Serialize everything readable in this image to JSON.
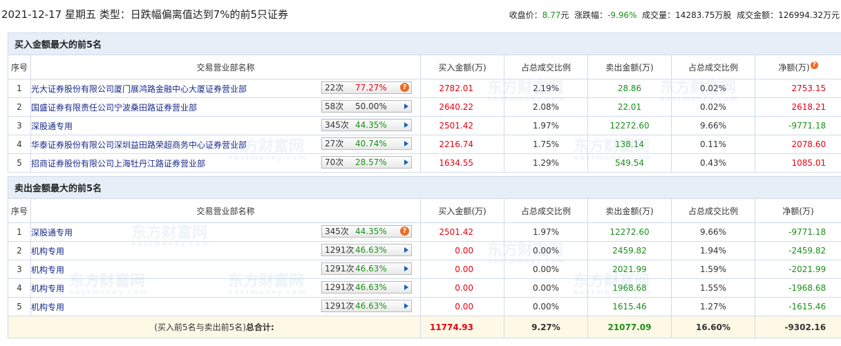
{
  "header": {
    "title": "2021-12-17 星期五 类型：日跌幅偏离值达到7%的前5只证券",
    "close_label": "收盘价：",
    "close_value": "8.77",
    "close_unit": "元",
    "change_label": "涨跌幅：",
    "change_value": "-9.96%",
    "volume_label": "成交量：",
    "volume_value": "14283.75万股",
    "amount_label": "成交金额：",
    "amount_value": "126994.32万元"
  },
  "columns": [
    "序号",
    "交易营业部名称",
    "买入金额(万)",
    "占总成交比例",
    "卖出金额(万)",
    "占总成交比例",
    "净额(万)"
  ],
  "buy_section": {
    "title": "买入金额最大的前5名",
    "rows": [
      {
        "idx": "1",
        "name": "光大证券股份有限公司厦门展鸿路金融中心大厦证券营业部",
        "count": "22次",
        "rate": "77.27%",
        "rate_color": "red",
        "icon": "hot",
        "buy": "2782.01",
        "buy_pct": "2.19%",
        "sell": "28.86",
        "sell_pct": "0.02%",
        "net": "2753.15",
        "net_color": "red"
      },
      {
        "idx": "2",
        "name": "国盛证券有限责任公司宁波桑田路证券营业部",
        "count": "58次",
        "rate": "50.00%",
        "rate_color": "black",
        "icon": "arrow",
        "buy": "2640.22",
        "buy_pct": "2.08%",
        "sell": "22.01",
        "sell_pct": "0.02%",
        "net": "2618.21",
        "net_color": "red"
      },
      {
        "idx": "3",
        "name": "深股通专用",
        "count": "345次",
        "rate": "44.35%",
        "rate_color": "green",
        "icon": "arrow",
        "buy": "2501.42",
        "buy_pct": "1.97%",
        "sell": "12272.60",
        "sell_pct": "9.66%",
        "net": "-9771.18",
        "net_color": "green"
      },
      {
        "idx": "4",
        "name": "华泰证券股份有限公司深圳益田路荣超商务中心证券营业部",
        "count": "27次",
        "rate": "40.74%",
        "rate_color": "green",
        "icon": "arrow",
        "buy": "2216.74",
        "buy_pct": "1.75%",
        "sell": "138.14",
        "sell_pct": "0.11%",
        "net": "2078.60",
        "net_color": "red"
      },
      {
        "idx": "5",
        "name": "招商证券股份有限公司上海牡丹江路证券营业部",
        "count": "70次",
        "rate": "28.57%",
        "rate_color": "green",
        "icon": "arrow",
        "buy": "1634.55",
        "buy_pct": "1.29%",
        "sell": "549.54",
        "sell_pct": "0.43%",
        "net": "1085.01",
        "net_color": "red"
      }
    ]
  },
  "sell_section": {
    "title": "卖出金额最大的前5名",
    "rows": [
      {
        "idx": "1",
        "name": "深股通专用",
        "count": "345次",
        "rate": "44.35%",
        "rate_color": "green",
        "icon": "hot",
        "buy": "2501.42",
        "buy_pct": "1.97%",
        "sell": "12272.60",
        "sell_pct": "9.66%",
        "net": "-9771.18",
        "net_color": "green"
      },
      {
        "idx": "2",
        "name": "机构专用",
        "count": "1291次",
        "rate": "46.63%",
        "rate_color": "green",
        "icon": "arrow",
        "buy": "0.00",
        "buy_pct": "0.00%",
        "sell": "2459.82",
        "sell_pct": "1.94%",
        "net": "-2459.82",
        "net_color": "green"
      },
      {
        "idx": "3",
        "name": "机构专用",
        "count": "1291次",
        "rate": "46.63%",
        "rate_color": "green",
        "icon": "arrow",
        "buy": "0.00",
        "buy_pct": "0.00%",
        "sell": "2021.99",
        "sell_pct": "1.59%",
        "net": "-2021.99",
        "net_color": "green"
      },
      {
        "idx": "4",
        "name": "机构专用",
        "count": "1291次",
        "rate": "46.63%",
        "rate_color": "green",
        "icon": "arrow",
        "buy": "0.00",
        "buy_pct": "0.00%",
        "sell": "1968.68",
        "sell_pct": "1.55%",
        "net": "-1968.68",
        "net_color": "green"
      },
      {
        "idx": "5",
        "name": "机构专用",
        "count": "1291次",
        "rate": "46.63%",
        "rate_color": "green",
        "icon": "arrow",
        "buy": "0.00",
        "buy_pct": "0.00%",
        "sell": "1615.46",
        "sell_pct": "1.27%",
        "net": "-1615.46",
        "net_color": "green"
      }
    ]
  },
  "total": {
    "label_prefix": "(买入前5名与卖出前5名)",
    "label_bold": "总合计:",
    "buy": "11774.93",
    "buy_pct": "9.27%",
    "sell": "21077.09",
    "sell_pct": "16.60%",
    "net": "-9302.16"
  },
  "watermark": {
    "cn": "东方财富网",
    "en": "eastmoney.com"
  },
  "icons": {
    "hot": "question-mark-badge-icon",
    "arrow": "play-arrow-icon"
  },
  "colors": {
    "red": "#e60012",
    "green": "#1a8f1a",
    "section_bg": "#e6eef8",
    "total_bg": "#fdf9e6",
    "border": "#cfdbe8"
  }
}
